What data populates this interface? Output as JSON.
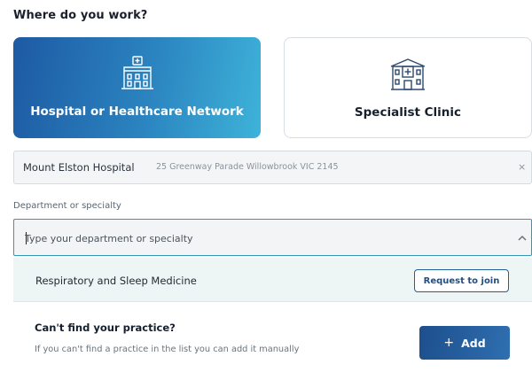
{
  "heading": "Where do you work?",
  "workplace_options": [
    {
      "label": "Hospital or Healthcare Network",
      "icon": "hospital-building-icon",
      "selected": true
    },
    {
      "label": "Specialist Clinic",
      "icon": "clinic-building-icon",
      "selected": false
    }
  ],
  "selected_hospital": {
    "name": "Mount Elston Hospital",
    "address": "25 Greenway Parade Willowbrook VIC 2145",
    "clear_icon": "×"
  },
  "department": {
    "label": "Department or specialty",
    "placeholder": "Type your department or specialty",
    "value": ""
  },
  "dropdown_option": {
    "label": "Respiratory and Sleep Medicine",
    "button_label": "Request to join"
  },
  "cant_find": {
    "title": "Can't find your practice?",
    "description": "If you can't find a practice in the list you can add it manually",
    "add_label": "Add",
    "add_icon": "+"
  },
  "colors": {
    "accent": "#2b84c0",
    "button_dark": "#1d4f8c",
    "focus_border": "#2e9ab4",
    "option_bg": "#eef6f5"
  }
}
